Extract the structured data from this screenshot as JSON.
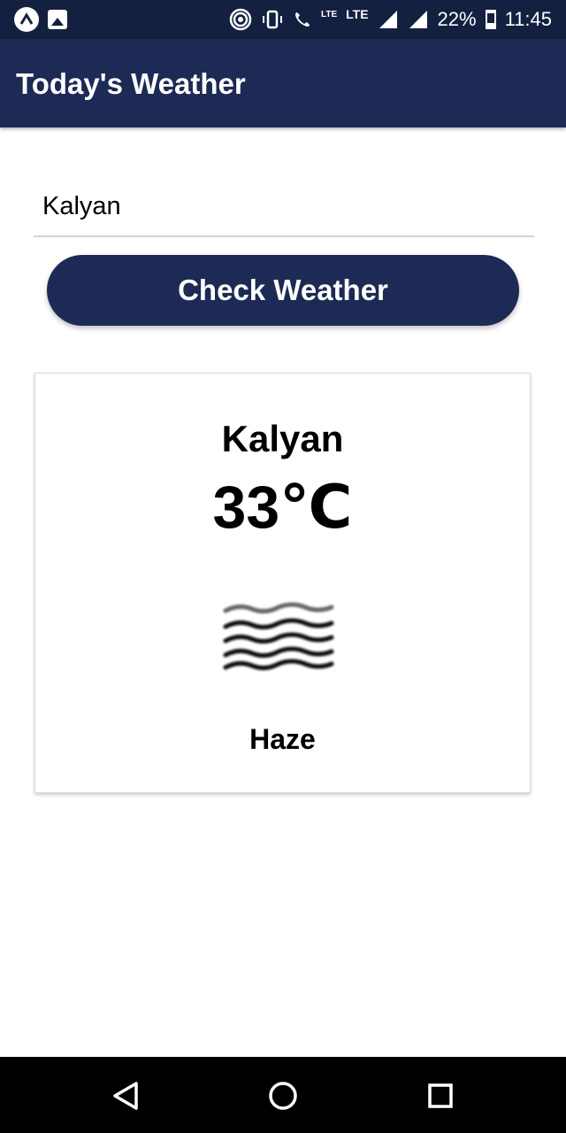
{
  "status_bar": {
    "battery": "22%",
    "time": "11:45",
    "lte_small": "LTE",
    "lte": "LTE"
  },
  "app": {
    "title": "Today's Weather"
  },
  "form": {
    "city_value": "Kalyan",
    "button_label": "Check Weather"
  },
  "weather": {
    "city": "Kalyan",
    "temperature": "33℃",
    "description": "Haze",
    "icon": "haze-icon"
  },
  "nav": {
    "back": "back-icon",
    "home": "home-icon",
    "recents": "recents-icon"
  },
  "colors": {
    "status_bar": "#13203f",
    "app_bar": "#1c2a55",
    "button": "#1c2a55"
  }
}
